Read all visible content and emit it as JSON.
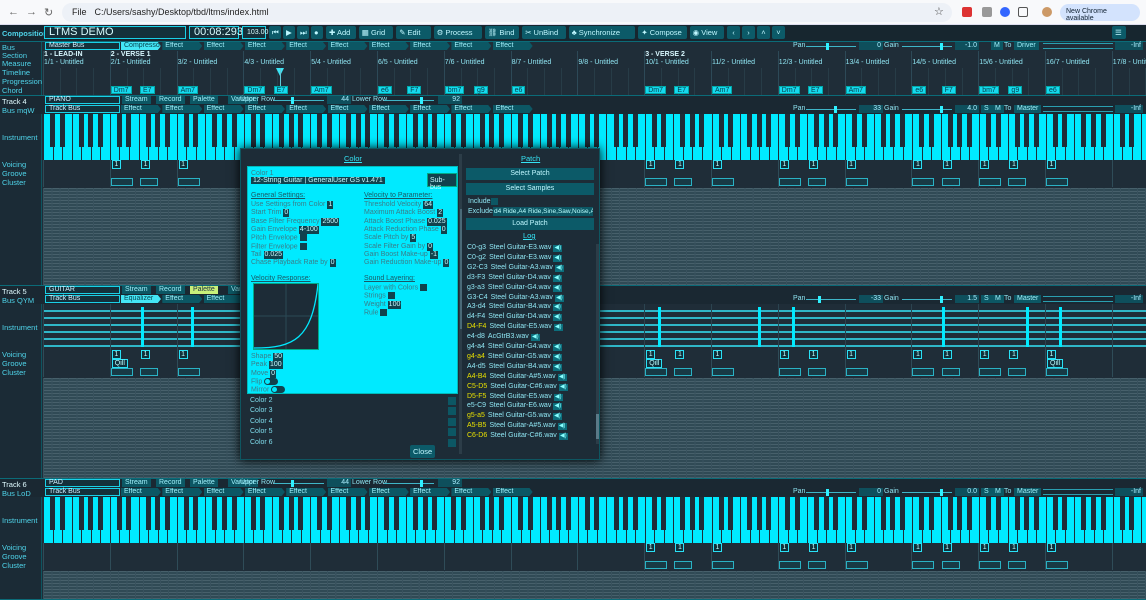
{
  "browser": {
    "url_prefix": "File",
    "url": "C:/Users/sashy/Desktop/tbd/ltms/index.html",
    "update_label": "New Chrome available"
  },
  "composition": {
    "label": "Composition",
    "title": "LTMS DEMO",
    "time": "00:08:293",
    "tempo": "103.00",
    "toolbar": [
      "Add",
      "Grid",
      "Edit",
      "Process",
      "Bind",
      "UnBind",
      "Synchronize",
      "Compose",
      "View"
    ],
    "nav": [
      "‹",
      "›",
      "˄",
      "˅"
    ]
  },
  "rows": {
    "bus": "Bus",
    "section": "Section",
    "measure": "Measure",
    "timeline": "Timeline",
    "progression": "Progression",
    "chord": "Chord",
    "instrument": "Instrument",
    "voicing": "Voicing",
    "groove": "Groove",
    "cluster": "Cluster"
  },
  "master": {
    "bus_name": "Master Bus",
    "effects": [
      {
        "label": "Compressor",
        "active": true
      },
      {
        "label": "Effect"
      },
      {
        "label": "Effect"
      },
      {
        "label": "Effect"
      },
      {
        "label": "Effect"
      },
      {
        "label": "Effect"
      },
      {
        "label": "Effect"
      },
      {
        "label": "Effect"
      },
      {
        "label": "Effect"
      },
      {
        "label": "Effect"
      }
    ],
    "pan_label": "Pan",
    "pan": "0",
    "gain_label": "Gain",
    "gain": "-1.0",
    "mute": "M",
    "to": "To",
    "output": "Driver",
    "level": "-Inf"
  },
  "sections": [
    {
      "label": "1 - LEAD-IN",
      "measure": 1
    },
    {
      "label": "2 - VERSE 1",
      "measure": 2
    },
    {
      "label": "3 - VERSE 2",
      "measure": 10
    }
  ],
  "measures": [
    "1/1 - Untitled",
    "2/1 - Untitled",
    "3/2 - Untitled",
    "4/3 - Untitled",
    "5/4 - Untitled",
    "6/5 - Untitled",
    "7/6 - Untitled",
    "8/7 - Untitled",
    "9/8 - Untitled",
    "10/1 - Untitled",
    "11/2 - Untitled",
    "12/3 - Untitled",
    "13/4 - Untitled",
    "14/5 - Untitled",
    "15/6 - Untitled",
    "16/7 - Untitled",
    "17/8 - Untitled"
  ],
  "chords": [
    {
      "label": "Dm7",
      "measure": 2,
      "beat": 0
    },
    {
      "label": "E7",
      "measure": 2,
      "beat": 1.75
    },
    {
      "label": "Am7",
      "measure": 3,
      "beat": 0
    },
    {
      "label": "Dm7",
      "measure": 4,
      "beat": 0
    },
    {
      "label": "E7",
      "measure": 4,
      "beat": 1.75
    },
    {
      "label": "Am7",
      "measure": 5,
      "beat": 0
    },
    {
      "label": "e6",
      "measure": 6,
      "beat": 0
    },
    {
      "label": "F7",
      "measure": 6,
      "beat": 1.75
    },
    {
      "label": "bm7",
      "measure": 7,
      "beat": 0
    },
    {
      "label": "g9",
      "measure": 7,
      "beat": 1.75
    },
    {
      "label": "e6",
      "measure": 8,
      "beat": 0
    },
    {
      "label": "Dm7",
      "measure": 10,
      "beat": 0
    },
    {
      "label": "E7",
      "measure": 10,
      "beat": 1.75
    },
    {
      "label": "Am7",
      "measure": 11,
      "beat": 0
    },
    {
      "label": "Dm7",
      "measure": 12,
      "beat": 0
    },
    {
      "label": "E7",
      "measure": 12,
      "beat": 1.75
    },
    {
      "label": "Am7",
      "measure": 13,
      "beat": 0
    },
    {
      "label": "e6",
      "measure": 14,
      "beat": 0
    },
    {
      "label": "F7",
      "measure": 14,
      "beat": 1.75
    },
    {
      "label": "bm7",
      "measure": 15,
      "beat": 0
    },
    {
      "label": "g9",
      "measure": 15,
      "beat": 1.75
    },
    {
      "label": "e6",
      "measure": 16,
      "beat": 0
    }
  ],
  "tracks": [
    {
      "label": "Track 4",
      "bus": "Bus mqW",
      "name": "PIANO",
      "kind": "keys",
      "buttons": [
        "Stream",
        "Record",
        "Palette",
        "Variator"
      ],
      "upper_label": "Upper Row",
      "upper": "44",
      "lower_label": "Lower Row",
      "lower": "92",
      "bus_name": "Track Bus",
      "effects": [
        "Effect",
        "Effect",
        "Effect",
        "Effect",
        "Effect",
        "Effect",
        "Effect",
        "Effect",
        "Effect",
        "Effect"
      ],
      "pan": "33",
      "gain": "4.0",
      "solo": "S",
      "mute": "M",
      "output": "Master",
      "level": "-Inf",
      "voicing": "1",
      "voicing_chords": "all",
      "groove": ""
    },
    {
      "label": "Track 5",
      "bus": "Bus QYM",
      "name": "GUITAR",
      "kind": "strings",
      "buttons": [
        "Stream",
        "Record",
        "Palette",
        "Variator"
      ],
      "active_button": "Palette",
      "bus_name": "Track Bus",
      "effects": [
        "Equalizer",
        "Effect",
        "Effect",
        "Effect",
        "Effect",
        "Effect",
        "Effect",
        "Effect",
        "Effect",
        "Effect"
      ],
      "active_effect": "Equalizer",
      "pan": "-33",
      "gain": "1.5",
      "solo": "S",
      "mute": "M",
      "output": "Master",
      "level": "-Inf",
      "voicing": "1",
      "groove": "Qill"
    },
    {
      "label": "Track 6",
      "bus": "Bus LoD",
      "name": "PAD",
      "kind": "keys",
      "buttons": [
        "Stream",
        "Record",
        "Palette",
        "Variator"
      ],
      "upper_label": "Upper Row",
      "upper": "44",
      "lower_label": "Lower Row",
      "lower": "92",
      "bus_name": "Track Bus",
      "effects": [
        "Effect",
        "Effect",
        "Effect",
        "Effect",
        "Effect",
        "Effect",
        "Effect",
        "Effect",
        "Effect",
        "Effect"
      ],
      "pan": "0",
      "gain": "0.0",
      "solo": "S",
      "mute": "M",
      "output": "Master",
      "level": "-Inf",
      "voicing": "1",
      "groove": ""
    }
  ],
  "dialog": {
    "color_title": "Color",
    "color_name": "Color 1",
    "patch_name": "12-String Guitar | GeneralUser GS v1.471",
    "subbus": "Sub-bus",
    "general_title": "General Settings:",
    "general": [
      {
        "k": "Use Settings from Color",
        "v": "1"
      },
      {
        "k": "Start Trim",
        "v": "0"
      },
      {
        "k": "Base Filter Frequency",
        "v": "2500"
      },
      {
        "k": "Gain Envelope",
        "v": "4-100"
      },
      {
        "k": "Pitch Envelope",
        "v": ""
      },
      {
        "k": "Filter Envelope",
        "v": ""
      },
      {
        "k": "Tail",
        "v": "0.025"
      },
      {
        "k": "Chase Playback Rate by",
        "v": "0"
      }
    ],
    "velocity_title": "Velocity to Parameter:",
    "velocity": [
      {
        "k": "Threshold Velocity",
        "v": "64"
      },
      {
        "k": "Maximum Attack Boost",
        "v": "2"
      },
      {
        "k": "Attack Boost Phase",
        "v": "0.025"
      },
      {
        "k": "Attack Reduction Phase",
        "v": "0"
      },
      {
        "k": "Scale Pitch by",
        "v": "5"
      },
      {
        "k": "Scale Filter Gain by",
        "v": "0"
      },
      {
        "k": "Gain Boost Make-up",
        "v": "-1"
      },
      {
        "k": "Gain Reduction Make-up",
        "v": "0"
      }
    ],
    "response_title": "Velocity Response:",
    "response": [
      {
        "k": "Shape",
        "v": "50"
      },
      {
        "k": "Peak",
        "v": "100"
      },
      {
        "k": "Move",
        "v": "0"
      }
    ],
    "flip": "Flip",
    "mirror": "Mirror",
    "layering_title": "Sound Layering:",
    "layering": [
      {
        "k": "Layer with Colors",
        "v": ""
      },
      {
        "k": "Strings",
        "v": ""
      },
      {
        "k": "Weight",
        "v": "100"
      },
      {
        "k": "Rule",
        "v": ""
      }
    ],
    "colors": [
      "Color 2",
      "Color 3",
      "Color 4",
      "Color 5",
      "Color 6"
    ],
    "close": "Close",
    "patch_title": "Patch",
    "select_patch": "Select Patch",
    "select_samples": "Select Samples",
    "include": "Include",
    "exclude": "Exclude",
    "exclude_value": "d4 Ride,A4 Ride,Sine,Saw,Noise,A",
    "load_patch": "Load Patch",
    "log_title": "Log",
    "log": [
      {
        "range": "C0-g3",
        "file": "Steel Guitar-E3.wav"
      },
      {
        "range": "C0-g2",
        "file": "Steel Guitar-E3.wav"
      },
      {
        "range": "G2-C3",
        "file": "Steel Guitar-A3.wav"
      },
      {
        "range": "d3-F3",
        "file": "Steel Guitar-D4.wav"
      },
      {
        "range": "g3-a3",
        "file": "Steel Guitar-G4.wav"
      },
      {
        "range": "G3-C4",
        "file": "Steel Guitar-A3.wav"
      },
      {
        "range": "A3-d4",
        "file": "Steel Guitar-B4.wav"
      },
      {
        "range": "d4-F4",
        "file": "Steel Guitar-D4.wav"
      },
      {
        "range": "D4-F4",
        "file": "Steel Guitar-E5.wav",
        "hl": true
      },
      {
        "range": "e4-d8",
        "file": "AcGtrB3.wav"
      },
      {
        "range": "g4-a4",
        "file": "Steel Guitar-G4.wav"
      },
      {
        "range": "g4-a4",
        "file": "Steel Guitar-G5.wav",
        "hl": true
      },
      {
        "range": "A4-d5",
        "file": "Steel Guitar-B4.wav"
      },
      {
        "range": "A4-B4",
        "file": "Steel Guitar-A#5.wav",
        "hl": true
      },
      {
        "range": "C5-D5",
        "file": "Steel Guitar-C#6.wav",
        "hl": true
      },
      {
        "range": "D5-F5",
        "file": "Steel Guitar-E5.wav",
        "hl": true
      },
      {
        "range": "e5-C9",
        "file": "Steel Guitar-E6.wav"
      },
      {
        "range": "g5-a5",
        "file": "Steel Guitar-G5.wav",
        "hl": true
      },
      {
        "range": "A5-B5",
        "file": "Steel Guitar-A#5.wav",
        "hl": true
      },
      {
        "range": "C6-D6",
        "file": "Steel Guitar-C#6.wav",
        "hl": true
      }
    ]
  },
  "colors": {
    "accent": "#00eaff",
    "background": "#1f2d38",
    "highlight": "#e8e000"
  }
}
